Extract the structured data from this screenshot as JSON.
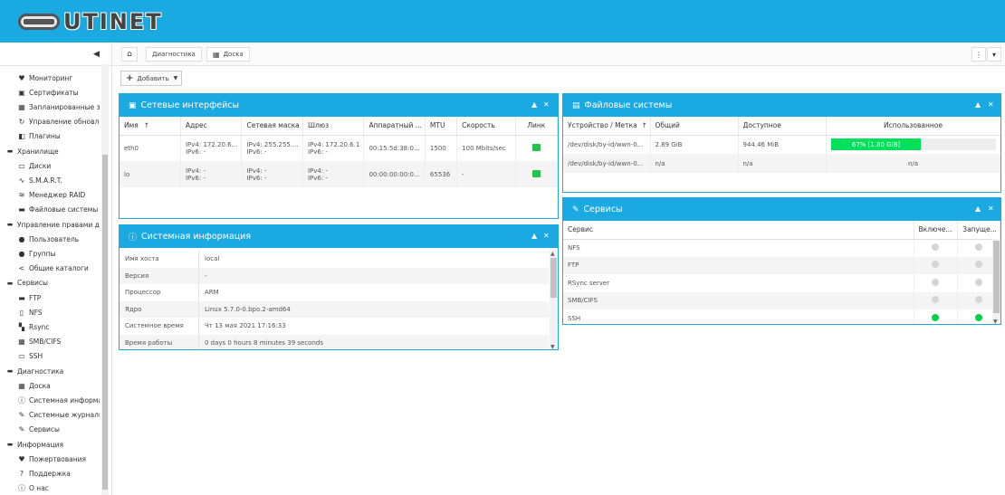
{
  "brand": {
    "logo_text": "UTINET"
  },
  "sidebar": {
    "collapse_icon": "chevron-left-icon",
    "items": [
      {
        "label": "Мониторинг",
        "icon": "heart-pulse-icon",
        "level": "child"
      },
      {
        "label": "Сертификаты",
        "icon": "certificate-icon",
        "level": "child"
      },
      {
        "label": "Запланированные задачи",
        "icon": "calendar-icon",
        "level": "child"
      },
      {
        "label": "Управление обновлениями",
        "icon": "refresh-icon",
        "level": "child"
      },
      {
        "label": "Плагины",
        "icon": "puzzle-icon",
        "level": "child"
      },
      {
        "label": "Хранилище",
        "icon": "minus-square-icon",
        "level": "group"
      },
      {
        "label": "Диски",
        "icon": "hdd-icon",
        "level": "child"
      },
      {
        "label": "S.M.A.R.T.",
        "icon": "pulse-icon",
        "level": "child"
      },
      {
        "label": "Менеджер RAID",
        "icon": "database-icon",
        "level": "child"
      },
      {
        "label": "Файловые системы",
        "icon": "folder-icon",
        "level": "child"
      },
      {
        "label": "Управление правами доступа",
        "icon": "minus-square-icon",
        "level": "group"
      },
      {
        "label": "Пользователь",
        "icon": "user-icon",
        "level": "child"
      },
      {
        "label": "Группы",
        "icon": "users-icon",
        "level": "child"
      },
      {
        "label": "Общие каталоги",
        "icon": "share-icon",
        "level": "child"
      },
      {
        "label": "Сервисы",
        "icon": "minus-square-icon",
        "level": "group"
      },
      {
        "label": "FTP",
        "icon": "folder-icon",
        "level": "child"
      },
      {
        "label": "NFS",
        "icon": "file-icon",
        "level": "child"
      },
      {
        "label": "Rsync",
        "icon": "sitemap-icon",
        "level": "child"
      },
      {
        "label": "SMB/CIFS",
        "icon": "windows-icon",
        "level": "child"
      },
      {
        "label": "SSH",
        "icon": "terminal-icon",
        "level": "child"
      },
      {
        "label": "Диагностика",
        "icon": "minus-square-icon",
        "level": "group"
      },
      {
        "label": "Доска",
        "icon": "dashboard-icon",
        "level": "child"
      },
      {
        "label": "Системная информация",
        "icon": "info-icon",
        "level": "child"
      },
      {
        "label": "Системные журналы",
        "icon": "edit-icon",
        "level": "child"
      },
      {
        "label": "Сервисы",
        "icon": "wrench-icon",
        "level": "child"
      },
      {
        "label": "Информация",
        "icon": "minus-square-icon",
        "level": "group"
      },
      {
        "label": "Пожертвования",
        "icon": "heart-icon",
        "level": "child"
      },
      {
        "label": "Поддержка",
        "icon": "question-icon",
        "level": "child"
      },
      {
        "label": "О нас",
        "icon": "info-icon",
        "level": "child"
      }
    ]
  },
  "topbar": {
    "home_icon": "home-icon",
    "crumb1": "Диагностика",
    "crumb2": "Доска",
    "crumb2_icon": "dashboard-icon",
    "menu_icon": "more-vertical-icon",
    "dropdown_icon": "caret-down-icon"
  },
  "toolbar": {
    "add_label": "Добавить"
  },
  "network": {
    "title": "Сетевые интерфейсы",
    "columns": [
      "Имя",
      "Адрес",
      "Сетевая маска",
      "Шлюз",
      "Аппаратный ...",
      "MTU",
      "Скорость",
      "Линк"
    ],
    "sort_glyph": "↑",
    "rows": [
      {
        "name": "eth0",
        "addr4": "IPv4: 172.20.6...",
        "addr6": "IPv6: -",
        "mask4": "IPv4: 255.255....",
        "mask6": "IPv6: -",
        "gw4": "IPv4: 172.20.6.1",
        "gw6": "IPv6: -",
        "mac": "00:15:5d:38:0...",
        "mtu": "1500",
        "speed": "100 Mbits/sec",
        "link": true
      },
      {
        "name": "lo",
        "addr4": "IPv4: -",
        "addr6": "IPv6: -",
        "mask4": "IPv4: -",
        "mask6": "IPv6: -",
        "gw4": "IPv4: -",
        "gw6": "IPv6: -",
        "mac": "00:00:00:00:0...",
        "mtu": "65536",
        "speed": "-",
        "link": true
      }
    ]
  },
  "sysinfo": {
    "title": "Системная информация",
    "rows": [
      {
        "key": "Имя хоста",
        "value": "local"
      },
      {
        "key": "Версия",
        "value": "-"
      },
      {
        "key": "Процессор",
        "value": "ARM"
      },
      {
        "key": "Ядро",
        "value": "Linux 5.7.0-0.bpo.2-amd64"
      },
      {
        "key": "Системное время",
        "value": "Чт 13 мая 2021 17:16:33"
      },
      {
        "key": "Время работы",
        "value": "0 days 0 hours 8 minutes 39 seconds"
      }
    ]
  },
  "filesystems": {
    "title": "Файловые системы",
    "columns": [
      "Устройство / Метка",
      "Общий",
      "Доступное",
      "Использованное"
    ],
    "sort_glyph": "↑",
    "rows": [
      {
        "device": "/dev/disk/by-id/wwn-0...",
        "total": "2.89 GiB",
        "available": "944.46 MiB",
        "used_text": "67% [1.80 GiB]",
        "used_pct": 67
      },
      {
        "device": "/dev/disk/by-id/wwn-0...",
        "total": "n/a",
        "available": "n/a",
        "used_text": "n/a",
        "used_pct": null
      }
    ]
  },
  "services": {
    "title": "Сервисы",
    "columns": [
      "Сервис",
      "Включе...",
      "Запуще..."
    ],
    "rows": [
      {
        "name": "NFS",
        "enabled": false,
        "running": false
      },
      {
        "name": "FTP",
        "enabled": false,
        "running": false
      },
      {
        "name": "RSync server",
        "enabled": false,
        "running": false
      },
      {
        "name": "SMB/CIFS",
        "enabled": false,
        "running": false
      },
      {
        "name": "SSH",
        "enabled": true,
        "running": true
      }
    ]
  },
  "colors": {
    "accent": "#1aa9e1",
    "ok": "#00d14a",
    "usage": "#00e05a"
  }
}
